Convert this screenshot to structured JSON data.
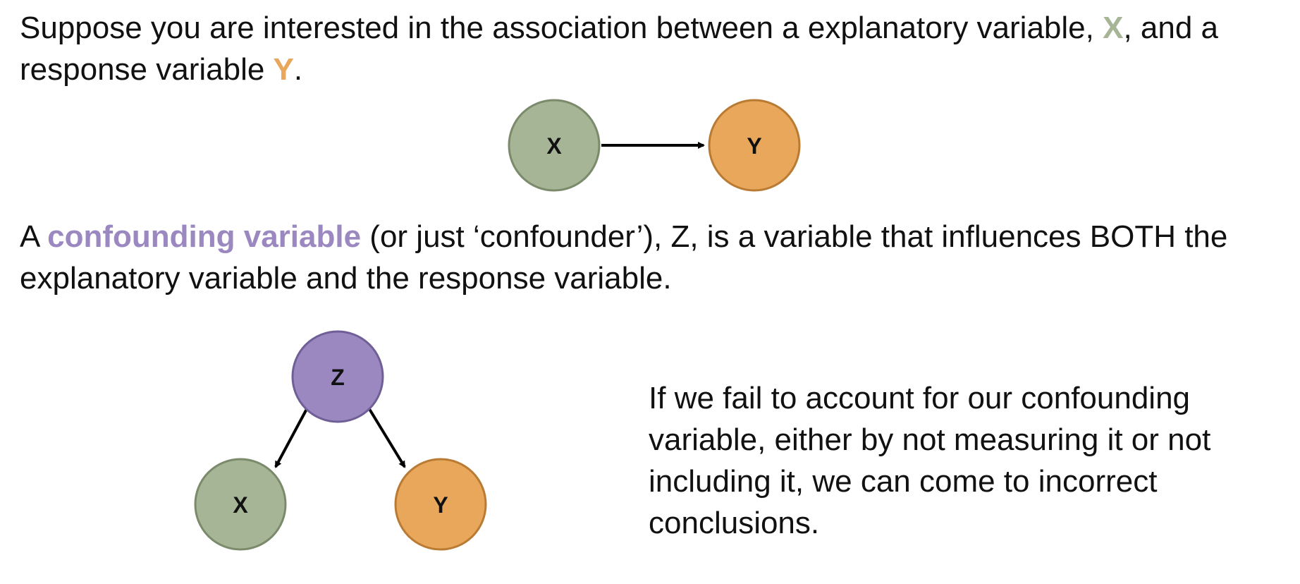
{
  "intro": {
    "part1": "Suppose you are interested in the association between a explanatory variable, ",
    "x": "X",
    "part2": ", and a response variable ",
    "y": "Y",
    "part3": "."
  },
  "definition": {
    "part1": "A ",
    "term": "confounding variable",
    "part2": " (or just ‘confounder’), Z, is a variable that influences BOTH the explanatory variable and the response variable."
  },
  "note": "If we fail to account for our confounding variable, either by not measuring it or not including it, we can come to incorrect conclusions.",
  "diagram1": {
    "x_label": "X",
    "y_label": "Y"
  },
  "diagram2": {
    "z_label": "Z",
    "x_label": "X",
    "y_label": "Y"
  },
  "colors": {
    "x_fill": "#a6b596",
    "x_stroke": "#7b8a6b",
    "y_fill": "#e8a75a",
    "y_stroke": "#b97b34",
    "z_fill": "#9b88c0",
    "z_stroke": "#6f5f96",
    "arrow": "#000000"
  }
}
